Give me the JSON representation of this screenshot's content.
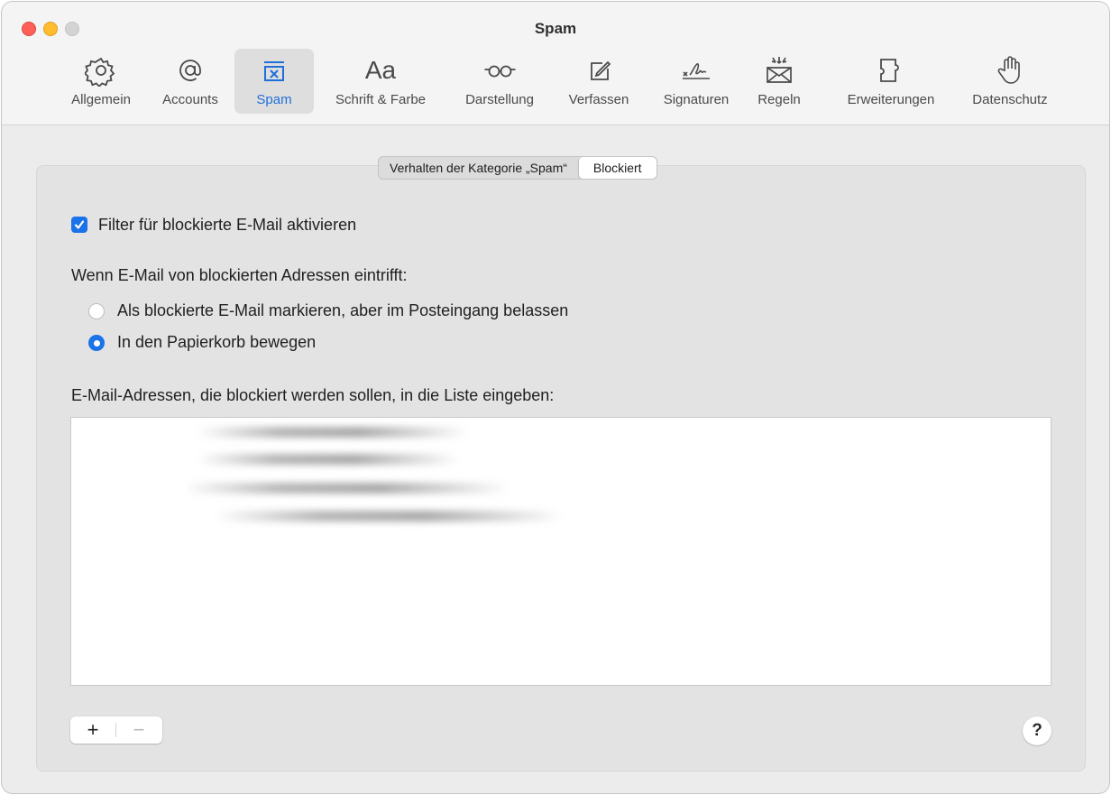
{
  "window": {
    "title": "Spam"
  },
  "toolbar": {
    "tabs": [
      {
        "label": "Allgemein",
        "icon": "gear-icon"
      },
      {
        "label": "Accounts",
        "icon": "at-sign-icon"
      },
      {
        "label": "Spam",
        "icon": "spam-tray-icon",
        "active": true
      },
      {
        "label": "Schrift & Farbe",
        "icon": "font-icon"
      },
      {
        "label": "Darstellung",
        "icon": "glasses-icon"
      },
      {
        "label": "Verfassen",
        "icon": "compose-icon"
      },
      {
        "label": "Signaturen",
        "icon": "signature-icon"
      },
      {
        "label": "Regeln",
        "icon": "rules-envelope-icon"
      },
      {
        "label": "Erweiterungen",
        "icon": "puzzle-icon"
      },
      {
        "label": "Datenschutz",
        "icon": "hand-icon"
      }
    ],
    "font_icon_glyph": "Aa"
  },
  "segmented": {
    "items": [
      "Verhalten der Kategorie „Spam“",
      "Blockiert"
    ],
    "selected": "Blockiert"
  },
  "blocked": {
    "enable_filter_label": "Filter für blockierte E-Mail aktivieren",
    "enable_filter_checked": true,
    "when_label": "Wenn E-Mail von blockierten Adressen eintrifft:",
    "option_mark_label": "Als blockierte E-Mail markieren, aber im Posteingang belassen",
    "option_trash_label": "In den Papierkorb bewegen",
    "selected_option": "In den Papierkorb bewegen",
    "list_label": "E-Mail-Adressen, die blockiert werden sollen, in die Liste eingeben:",
    "add_glyph": "+",
    "remove_glyph": "−",
    "help_glyph": "?"
  },
  "colors": {
    "accent": "#1a73e8",
    "active_tab_label": "#1f6fd8",
    "close": "#fe5f57",
    "minimize": "#febc2e"
  }
}
